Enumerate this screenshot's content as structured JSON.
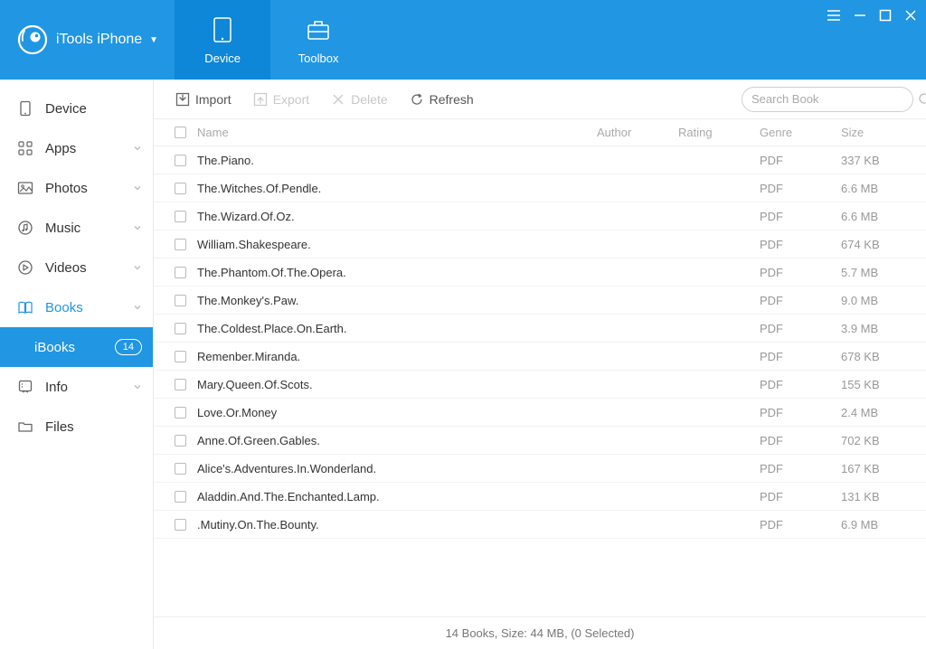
{
  "header": {
    "brand_text": "iTools iPhone",
    "tabs": [
      {
        "label": "Device",
        "active": true
      },
      {
        "label": "Toolbox",
        "active": false
      }
    ]
  },
  "sidebar": {
    "items": [
      {
        "icon": "device",
        "label": "Device",
        "chevron": false
      },
      {
        "icon": "apps",
        "label": "Apps",
        "chevron": true
      },
      {
        "icon": "photos",
        "label": "Photos",
        "chevron": true
      },
      {
        "icon": "music",
        "label": "Music",
        "chevron": true
      },
      {
        "icon": "videos",
        "label": "Videos",
        "chevron": true
      },
      {
        "icon": "books",
        "label": "Books",
        "chevron": true,
        "accent": true
      },
      {
        "icon": "",
        "label": "iBooks",
        "sub": true,
        "active": true,
        "badge": "14"
      },
      {
        "icon": "info",
        "label": "Info",
        "chevron": true
      },
      {
        "icon": "files",
        "label": "Files",
        "chevron": false
      }
    ]
  },
  "toolbar": {
    "import_label": "Import",
    "export_label": "Export",
    "delete_label": "Delete",
    "refresh_label": "Refresh",
    "search_placeholder": "Search Book"
  },
  "table": {
    "headers": {
      "name": "Name",
      "author": "Author",
      "rating": "Rating",
      "genre": "Genre",
      "size": "Size"
    },
    "rows": [
      {
        "name": "The.Piano.",
        "author": "",
        "rating": "",
        "genre": "PDF",
        "size": "337 KB"
      },
      {
        "name": "The.Witches.Of.Pendle.",
        "author": "",
        "rating": "",
        "genre": "PDF",
        "size": "6.6 MB"
      },
      {
        "name": "The.Wizard.Of.Oz.",
        "author": "",
        "rating": "",
        "genre": "PDF",
        "size": "6.6 MB"
      },
      {
        "name": "William.Shakespeare.",
        "author": "",
        "rating": "",
        "genre": "PDF",
        "size": "674 KB"
      },
      {
        "name": "The.Phantom.Of.The.Opera.",
        "author": "",
        "rating": "",
        "genre": "PDF",
        "size": "5.7 MB"
      },
      {
        "name": "The.Monkey's.Paw.",
        "author": "",
        "rating": "",
        "genre": "PDF",
        "size": "9.0 MB"
      },
      {
        "name": "The.Coldest.Place.On.Earth.",
        "author": "",
        "rating": "",
        "genre": "PDF",
        "size": "3.9 MB"
      },
      {
        "name": "Remenber.Miranda.",
        "author": "",
        "rating": "",
        "genre": "PDF",
        "size": "678 KB"
      },
      {
        "name": "Mary.Queen.Of.Scots.",
        "author": "",
        "rating": "",
        "genre": "PDF",
        "size": "155 KB"
      },
      {
        "name": "Love.Or.Money",
        "author": "",
        "rating": "",
        "genre": "PDF",
        "size": "2.4 MB"
      },
      {
        "name": "Anne.Of.Green.Gables.",
        "author": "",
        "rating": "",
        "genre": "PDF",
        "size": "702 KB"
      },
      {
        "name": "Alice's.Adventures.In.Wonderland.",
        "author": "",
        "rating": "",
        "genre": "PDF",
        "size": "167 KB"
      },
      {
        "name": "Aladdin.And.The.Enchanted.Lamp.",
        "author": "",
        "rating": "",
        "genre": "PDF",
        "size": "131 KB"
      },
      {
        "name": ".Mutiny.On.The.Bounty.",
        "author": "",
        "rating": "",
        "genre": "PDF",
        "size": "6.9 MB"
      }
    ]
  },
  "statusbar": {
    "text": "14 Books, Size: 44 MB, (0 Selected)"
  }
}
